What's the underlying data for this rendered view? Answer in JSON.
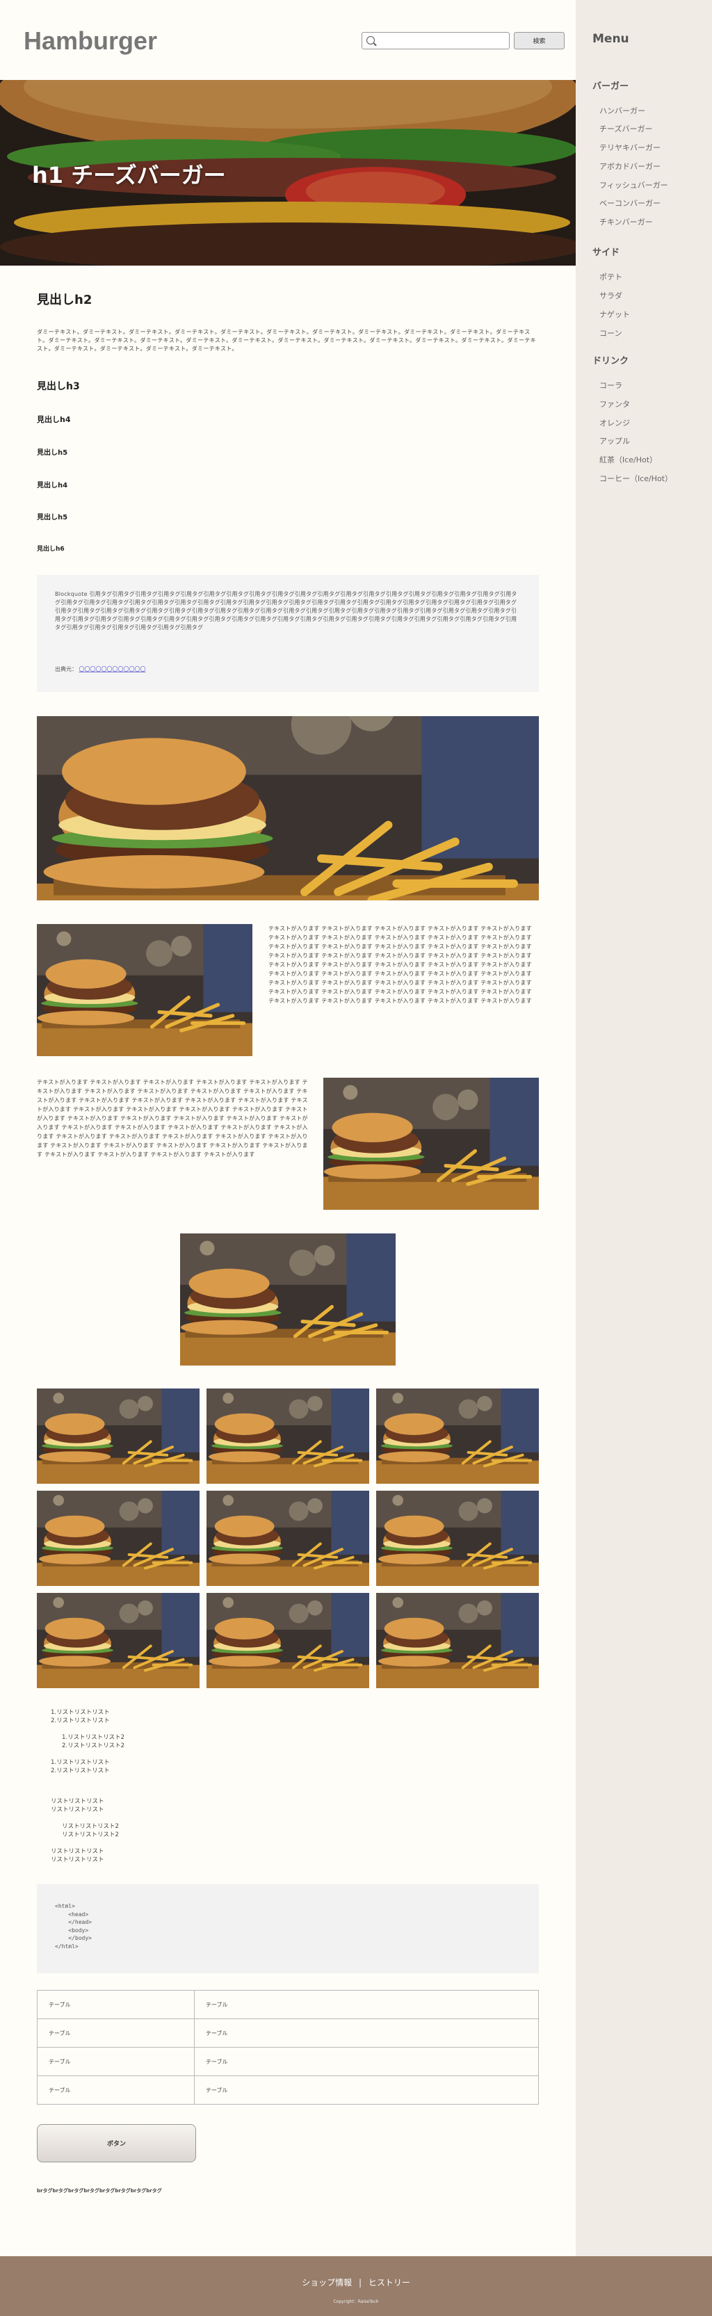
{
  "header": {
    "logo": "Hamburger",
    "search_placeholder": "",
    "search_button": "検索"
  },
  "hero": {
    "title": "h1 チーズバーガー"
  },
  "article": {
    "h2": "見出しh2",
    "paragraph": "ダミーテキスト。ダミーテキスト。ダミーテキスト。ダミーテキスト。ダミーテキスト。ダミーテキスト。ダミーテキスト。ダミーテキスト。ダミーテキスト。ダミーテキスト。ダミーテキスト。ダミーテキスト。ダミーテキスト。ダミーテキスト。ダミーテキスト。ダミーテキスト。ダミーテキスト。ダミーテキスト。ダミーテキスト。ダミーテキスト。ダミーテキスト。ダミーテキスト。ダミーテキスト。ダミーテキスト。ダミーテキスト。ダミーテキスト。",
    "h3": "見出しh3",
    "h4": "見出しh4",
    "h5a": "見出しh5",
    "h4b": "見出しh4",
    "h5": "見出しh5",
    "h6": "見出しh6",
    "quote_text": "Blockquote 引用タグ引用タグ引用タグ引用タグ引用タグ引用タグ引用タグ引用タグ引用タグ引用タグ引用タグ引用タグ引用タグ引用タグ引用タグ引用タグ引用タグ引用タグ引用タグ引用タグ引用タグ引用タグ引用タグ引用タグ引用タグ引用タグ引用タグ引用タグ引用タグ引用タグ引用タグ引用タグ引用タグ引用タグ引用タグ引用タグ引用タグ引用タグ引用タグ引用タグ引用タグ引用タグ引用タグ引用タグ引用タグ引用タグ引用タグ引用タグ引用タグ引用タグ引用タグ引用タグ引用タグ引用タグ引用タグ引用タグ引用タグ引用タグ引用タグ引用タグ引用タグ引用タグ引用タグ引用タグ引用タグ引用タグ引用タグ引用タグ引用タグ引用タグ引用タグ引用タグ引用タグ引用タグ引用タグ引用タグ引用タグ引用タグ引用タグ引用タグ引用タグ引用タグ引用タグ引用タグ引用タグ引用タグ",
    "quote_source_label": "出典元：",
    "quote_source_link": "〇〇〇〇〇〇〇〇〇〇〇〇",
    "text_right": "テキストが入ります テキストが入ります テキストが入ります テキストが入ります テキストが入ります テキストが入ります テキストが入ります テキストが入ります テキストが入ります テキストが入ります テキストが入ります テキストが入ります テキストが入ります テキストが入ります テキストが入ります テキストが入ります テキストが入ります テキストが入ります テキストが入ります テキストが入ります テキストが入ります テキストが入ります テキストが入ります テキストが入ります テキストが入ります テキストが入ります テキストが入ります テキストが入ります テキストが入ります テキストが入ります テキストが入ります テキストが入ります テキストが入ります テキストが入ります テキストが入ります テキストが入ります テキストが入ります テキストが入ります テキストが入ります テキストが入ります テキストが入ります テキストが入ります テキストが入ります テキストが入ります テキストが入ります",
    "text_left": "テキストが入ります テキストが入ります テキストが入ります テキストが入ります テキストが入ります テキストが入ります テキストが入ります テキストが入ります テキストが入ります テキストが入ります テキストが入ります テキストが入ります テキストが入ります テキストが入ります テキストが入ります テキストが入ります テキストが入ります テキストが入ります テキストが入ります テキストが入ります テキストが入ります テキストが入ります テキストが入ります テキストが入ります テキストが入ります テキストが入ります テキストが入ります テキストが入ります テキストが入ります テキストが入ります テキストが入ります テキストが入ります テキストが入ります テキストが入ります テキストが入ります テキストが入ります テキストが入ります テキストが入ります テキストが入ります テキストが入ります テキストが入ります テキストが入ります テキストが入ります テキストが入ります テキストが入ります"
  },
  "lists": {
    "ol1": [
      "1.リストリストリスト",
      "2.リストリストリスト"
    ],
    "ol1_nested": [
      "1.リストリストリスト2",
      "2.リストリストリスト2"
    ],
    "ol2": [
      "1.リストリストリスト",
      "2.リストリストリスト"
    ],
    "ul1": [
      "リストリストリスト",
      "リストリストリスト"
    ],
    "ul1_nested": [
      "リストリストリスト2",
      "リストリストリスト2"
    ],
    "ul2": [
      "リストリストリスト",
      "リストリストリスト"
    ]
  },
  "code": "<html>\n    <head>\n    </head>\n    <body>\n    </body>\n</html>",
  "table": [
    [
      "テーブル",
      "テーブル"
    ],
    [
      "テーブル",
      "テーブル"
    ],
    [
      "テーブル",
      "テーブル"
    ],
    [
      "テーブル",
      "テーブル"
    ]
  ],
  "button_label": "ボタン",
  "br_text": "brタグbrタグbrタグbrタグbrタグbrタグbrタグbrタグ",
  "sidebar": {
    "title": "Menu",
    "categories": [
      {
        "name": "バーガー",
        "items": [
          "ハンバーガー",
          "チーズバーガー",
          "テリヤキバーガー",
          "アボカドバーガー",
          "フィッシュバーガー",
          "ベーコンバーガー",
          "チキンバーガー"
        ]
      },
      {
        "name": "サイド",
        "items": [
          "ポテト",
          "サラダ",
          "ナゲット",
          "コーン"
        ]
      },
      {
        "name": "ドリンク",
        "items": [
          "コーラ",
          "ファンタ",
          "オレンジ",
          "アップル",
          "紅茶（Ice/Hot）",
          "コーヒー（Ice/Hot）"
        ]
      }
    ]
  },
  "footer": {
    "links": [
      "ショップ情報",
      "ヒストリー"
    ],
    "separator": "|",
    "copyright": "Copyright：RaiseTech"
  },
  "colors": {
    "sidebar_bg": "#f1ebe6",
    "footer_bg": "#977d6a",
    "page_bg": "#fffdf8"
  }
}
